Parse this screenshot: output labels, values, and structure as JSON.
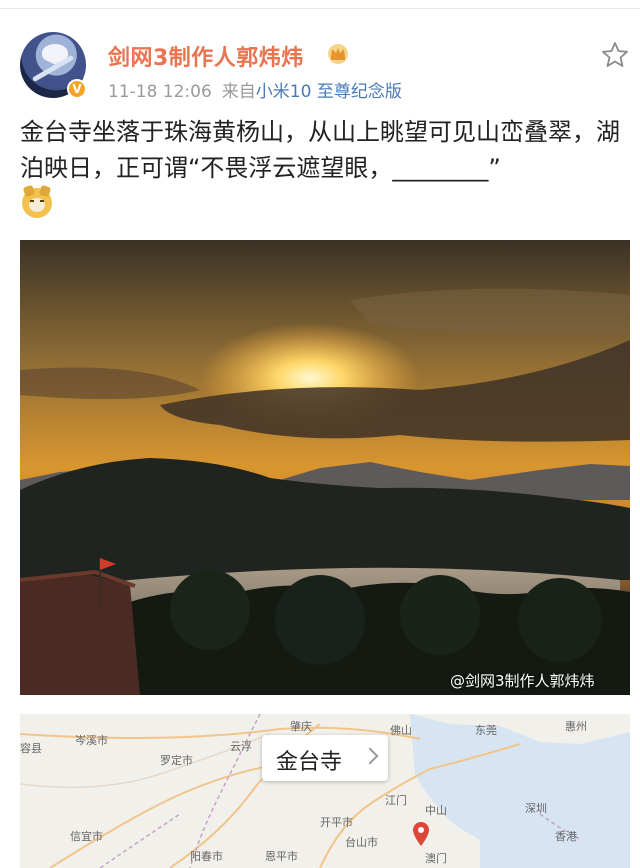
{
  "header": {
    "username": "剑网3制作人郭炜炜",
    "timestamp": "11-18 12:06",
    "source_prefix": "来自",
    "source_device": "小米10 至尊纪念版"
  },
  "post": {
    "text": "金台寺坐落于珠海黄杨山，从山上眺望可见山峦叠翠，湖泊映日，正可谓“不畏浮云遮望眼，________”",
    "emoji": "doge-emoji"
  },
  "photo": {
    "watermark": "@剑网3制作人郭炜炜"
  },
  "map": {
    "poi_name": "金台寺",
    "labels": {
      "zhaoqing": "肇庆",
      "foshan": "佛山",
      "dongguan": "东莞",
      "huizhou": "惠州",
      "yunfu": "云浮",
      "luoding": "罗定市",
      "jiangmen": "江门",
      "zhongshan": "中山",
      "shenzhen": "深圳",
      "hongkong": "香港",
      "macau": "澳门",
      "taishan": "台山市",
      "kaiping": "开平市",
      "xinyi": "信宜市",
      "yangchun": "阳春市",
      "enping": "恩平市",
      "cenxi": "岑溪市",
      "county": "容县"
    }
  },
  "colors": {
    "username": "#eb7350",
    "source_link": "#4a7ab5",
    "meta": "#9a9a9a"
  }
}
